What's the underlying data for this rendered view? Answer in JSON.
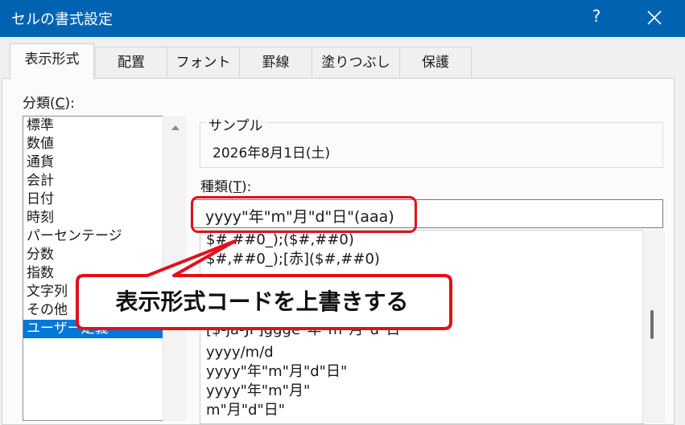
{
  "window": {
    "title": "セルの書式設定",
    "help_label": "?"
  },
  "tabs": [
    {
      "label": "表示形式"
    },
    {
      "label": "配置"
    },
    {
      "label": "フォント"
    },
    {
      "label": "罫線"
    },
    {
      "label": "塗りつぶし"
    },
    {
      "label": "保護"
    }
  ],
  "category": {
    "label_prefix": "分類(",
    "label_key": "C",
    "label_suffix": "):",
    "items": [
      "標準",
      "数値",
      "通貨",
      "会計",
      "日付",
      "時刻",
      "パーセンテージ",
      "分数",
      "指数",
      "文字列",
      "その他",
      "ユーザー定義"
    ],
    "selected": "ユーザー定義"
  },
  "sample": {
    "legend": "サンプル",
    "value": "2026年8月1日(土)"
  },
  "type": {
    "label_prefix": "種類(",
    "label_key": "T",
    "label_suffix": "):",
    "input_value": "yyyy\"年\"m\"月\"d\"日\"(aaa)"
  },
  "format_list": [
    "$#,##0_);($#,##0)",
    "$#,##0_);[赤]($#,##0)",
    "[$-ja-JP]ggge\"年\"m\"月\"d\"日\"",
    "yyyy/m/d",
    "yyyy\"年\"m\"月\"d\"日\"",
    "yyyy\"年\"m\"月\"",
    "m\"月\"d\"日\""
  ],
  "callout": {
    "text": "表示形式コードを上書きする"
  },
  "colors": {
    "titlebar": "#0063b1",
    "selection": "#0078d7",
    "highlight": "#e3101a"
  }
}
